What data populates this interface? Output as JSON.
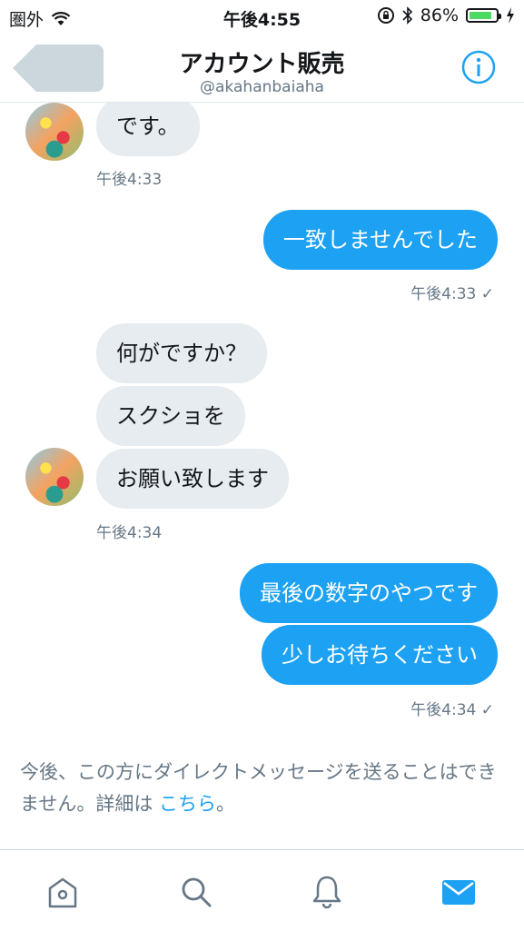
{
  "status_bar": {
    "carrier": "圏外",
    "time": "午後4:55",
    "battery": "86%",
    "battery_level": 0.86
  },
  "header": {
    "title": "アカウント販売",
    "handle": "@akahanbaiaha"
  },
  "messages": [
    {
      "dir": "in",
      "text": "です。"
    },
    {
      "dir": "ts",
      "text": "午後4:33"
    },
    {
      "dir": "out",
      "text": "一致しませんでした"
    },
    {
      "dir": "ts",
      "text": "午後4:33 ✓"
    },
    {
      "dir": "in",
      "text": "何がですか？"
    },
    {
      "dir": "in",
      "text": "スクショを"
    },
    {
      "dir": "in",
      "text": "お願い致します"
    },
    {
      "dir": "ts",
      "text": "午後4:34"
    },
    {
      "dir": "out",
      "text": "最後の数字のやつです"
    },
    {
      "dir": "out",
      "text": "少しお待ちください"
    },
    {
      "dir": "ts",
      "text": "午後4:34 ✓"
    }
  ],
  "notice": {
    "text": "今後、この方にダイレクトメッセージを送ることはできません。詳細は ",
    "link": "こちら",
    "end": "。"
  },
  "tabs": [
    {
      "name": "home-icon"
    },
    {
      "name": "search-icon"
    },
    {
      "name": "bell-icon"
    },
    {
      "name": "mail-icon",
      "active": true
    }
  ],
  "colors": {
    "accent": "#1da1f2",
    "incoming_bubble": "#e6ecf0",
    "muted": "#657786"
  }
}
